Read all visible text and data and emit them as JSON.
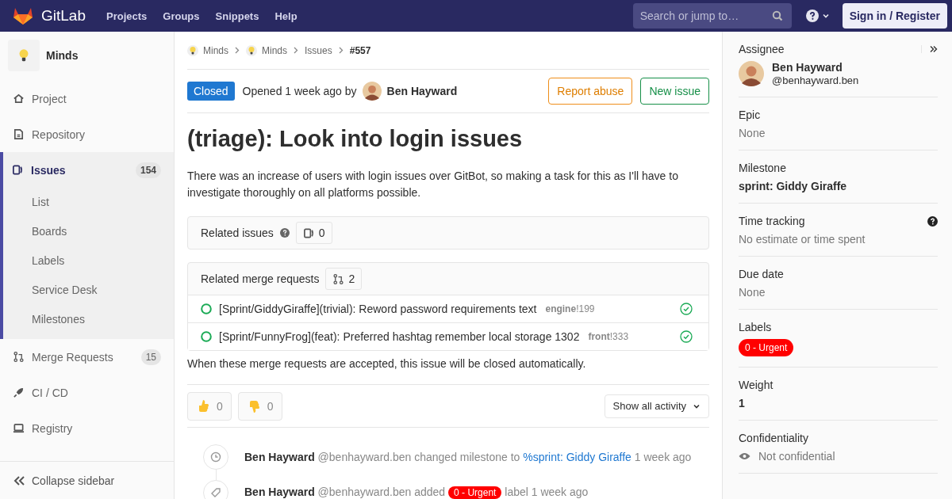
{
  "navbar": {
    "brand": "GitLab",
    "links": [
      "Projects",
      "Groups",
      "Snippets",
      "Help"
    ],
    "search": {
      "placeholder": "Search or jump to…"
    },
    "sign_in": "Sign in / Register"
  },
  "sidebar": {
    "project": "Minds",
    "items": [
      {
        "label": "Project",
        "selected": false
      },
      {
        "label": "Repository",
        "selected": false
      },
      {
        "label": "Issues",
        "selected": true,
        "count": "154",
        "children": [
          {
            "label": "List"
          },
          {
            "label": "Boards"
          },
          {
            "label": "Labels"
          },
          {
            "label": "Service Desk"
          },
          {
            "label": "Milestones"
          }
        ]
      },
      {
        "label": "Merge Requests",
        "selected": false,
        "count": "15"
      },
      {
        "label": "CI / CD",
        "selected": false
      },
      {
        "label": "Registry",
        "selected": false
      }
    ],
    "collapse": "Collapse sidebar"
  },
  "breadcrumbs": [
    {
      "label": "Minds",
      "kind": "project"
    },
    {
      "label": "Minds",
      "kind": "project"
    },
    {
      "label": "Issues",
      "kind": "page"
    },
    {
      "label": "#557",
      "kind": "current"
    }
  ],
  "issue": {
    "status": "Closed",
    "opened": "Opened 1 week ago by",
    "author": "Ben Hayward",
    "actions": [
      {
        "label": "Report abuse",
        "kind": "warning"
      },
      {
        "label": "New issue",
        "kind": "success"
      }
    ],
    "title": "(triage): Look into login issues",
    "description": "There was an increase of users with login issues over GitBot, so making a task for this as I'll have to investigate thoroughly on all platforms possible."
  },
  "related_issues": {
    "title": "Related issues",
    "count": "0"
  },
  "related_merge_requests": {
    "title": "Related merge requests",
    "count": "2",
    "items": [
      {
        "title": "[Sprint/GiddyGiraffe](trivial): Reword password requirements text",
        "project": "engine",
        "ref": "!199"
      },
      {
        "title": "[Sprint/FunnyFrog](feat): Preferred hashtag remember local storage 1302",
        "project": "front",
        "ref": "!333"
      }
    ],
    "note": "When these merge requests are accepted, this issue will be closed automatically."
  },
  "awards": [
    {
      "kind": "thumbsup",
      "count": "0"
    },
    {
      "kind": "thumbsdown",
      "count": "0"
    }
  ],
  "activity_filter": "Show all activity",
  "notes": [
    {
      "kind": "milestone",
      "author": "Ben Hayward",
      "username": "@benhayward.ben",
      "action": "changed milestone to",
      "link": "%sprint: Giddy Giraffe",
      "time": "1 week ago"
    },
    {
      "kind": "label",
      "author": "Ben Hayward",
      "username": "@benhayward.ben",
      "action": "added",
      "label": {
        "text": "0 - Urgent",
        "color": "#ff0000"
      },
      "after": "label",
      "time": "1 week ago"
    }
  ],
  "right_sidebar": [
    {
      "kind": "assignee",
      "title": "Assignee",
      "name": "Ben Hayward",
      "username": "@benhayward.ben"
    },
    {
      "kind": "muted",
      "title": "Epic",
      "value": "None"
    },
    {
      "kind": "bold",
      "title": "Milestone",
      "value": "sprint: Giddy Giraffe"
    },
    {
      "kind": "help",
      "title": "Time tracking",
      "value": "No estimate or time spent"
    },
    {
      "kind": "muted",
      "title": "Due date",
      "value": "None"
    },
    {
      "kind": "labels",
      "title": "Labels",
      "labels": [
        {
          "text": "0 - Urgent",
          "color": "#ff0000"
        }
      ]
    },
    {
      "kind": "bold",
      "title": "Weight",
      "value": "1"
    },
    {
      "kind": "eye",
      "title": "Confidentiality",
      "value": "Not confidential"
    }
  ]
}
